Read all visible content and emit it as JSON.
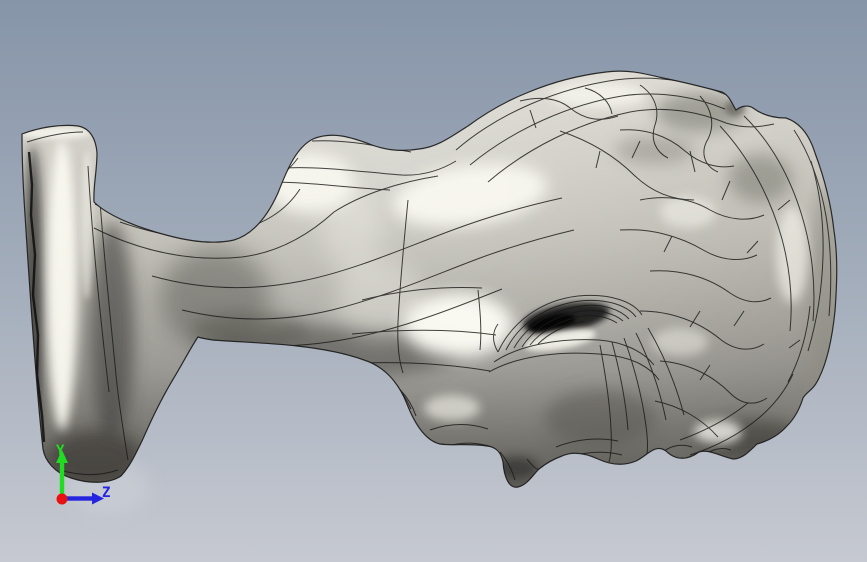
{
  "scene": {
    "model": "classical-head-bust",
    "render_style": "shaded-with-edges",
    "view": "side-view-model-lying-on-back",
    "background_top": "#8795a9",
    "background_bottom": "#c6c9d1",
    "model_base_color": "#b2b0a6",
    "edge_color": "#1a1a18",
    "highlight_color": "#faf9f1"
  },
  "axis_triad": {
    "y_label": "Y",
    "z_label": "Z",
    "y_color": "#21dd21",
    "z_color": "#2525e0",
    "origin_color": "#e81010"
  }
}
